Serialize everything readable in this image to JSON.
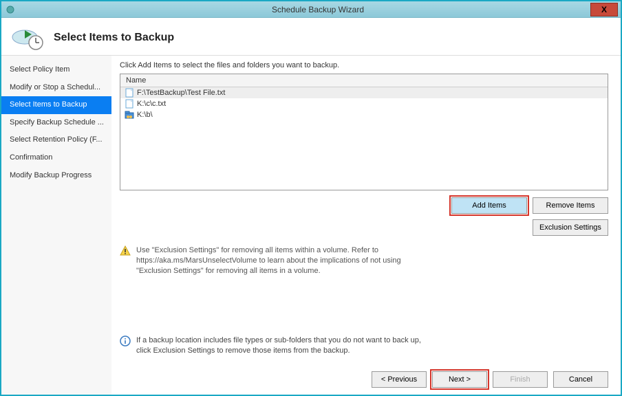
{
  "window": {
    "title": "Schedule Backup Wizard",
    "close_symbol": "X"
  },
  "header": {
    "title": "Select Items to Backup"
  },
  "sidebar": {
    "items": [
      {
        "label": "Select Policy Item"
      },
      {
        "label": "Modify or Stop a Schedul..."
      },
      {
        "label": "Select Items to Backup"
      },
      {
        "label": "Specify Backup Schedule ..."
      },
      {
        "label": "Select Retention Policy (F..."
      },
      {
        "label": "Confirmation"
      },
      {
        "label": "Modify Backup Progress"
      }
    ],
    "selected_index": 2
  },
  "main": {
    "instruction": "Click Add Items to select the files and folders you want to backup.",
    "list_header": "Name",
    "items": [
      {
        "icon": "file",
        "path": "F:\\TestBackup\\Test File.txt",
        "selected": true
      },
      {
        "icon": "file",
        "path": "K:\\c\\c.txt",
        "selected": false
      },
      {
        "icon": "folder-group",
        "path": "K:\\b\\",
        "selected": false
      }
    ],
    "buttons": {
      "add": "Add Items",
      "remove": "Remove Items",
      "exclusion": "Exclusion Settings"
    },
    "warning_text": "Use \"Exclusion Settings\" for removing all items within a volume. Refer to https://aka.ms/MarsUnselectVolume to learn about the implications of not using \"Exclusion Settings\" for removing all items in a volume.",
    "info_text": "If a backup location includes file types or sub-folders that you do not want to back up, click Exclusion Settings to remove those items from the backup."
  },
  "footer": {
    "previous": "< Previous",
    "next": "Next >",
    "finish": "Finish",
    "cancel": "Cancel"
  }
}
